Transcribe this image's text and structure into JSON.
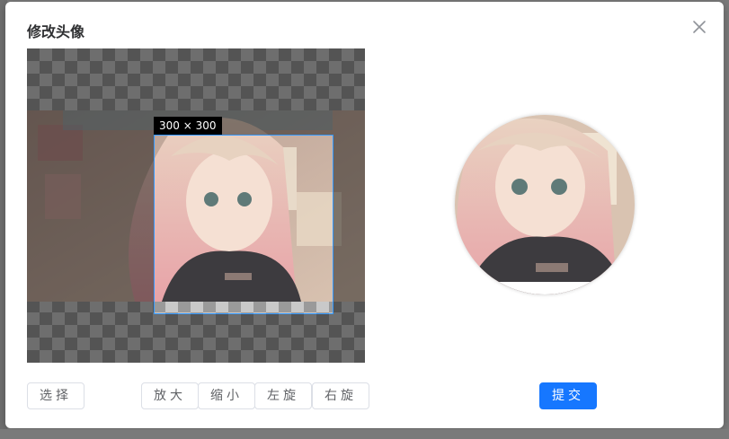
{
  "dialog": {
    "title": "修改头像",
    "close_icon": "close-icon",
    "crop_size_label": "300 × 300"
  },
  "buttons": {
    "select": "选择",
    "zoom_in": "放大",
    "zoom_out": "缩小",
    "rotate_left": "左旋",
    "rotate_right": "右旋",
    "submit": "提交"
  },
  "colors": {
    "primary": "#1677ff",
    "crop_border": "#3399ff"
  }
}
